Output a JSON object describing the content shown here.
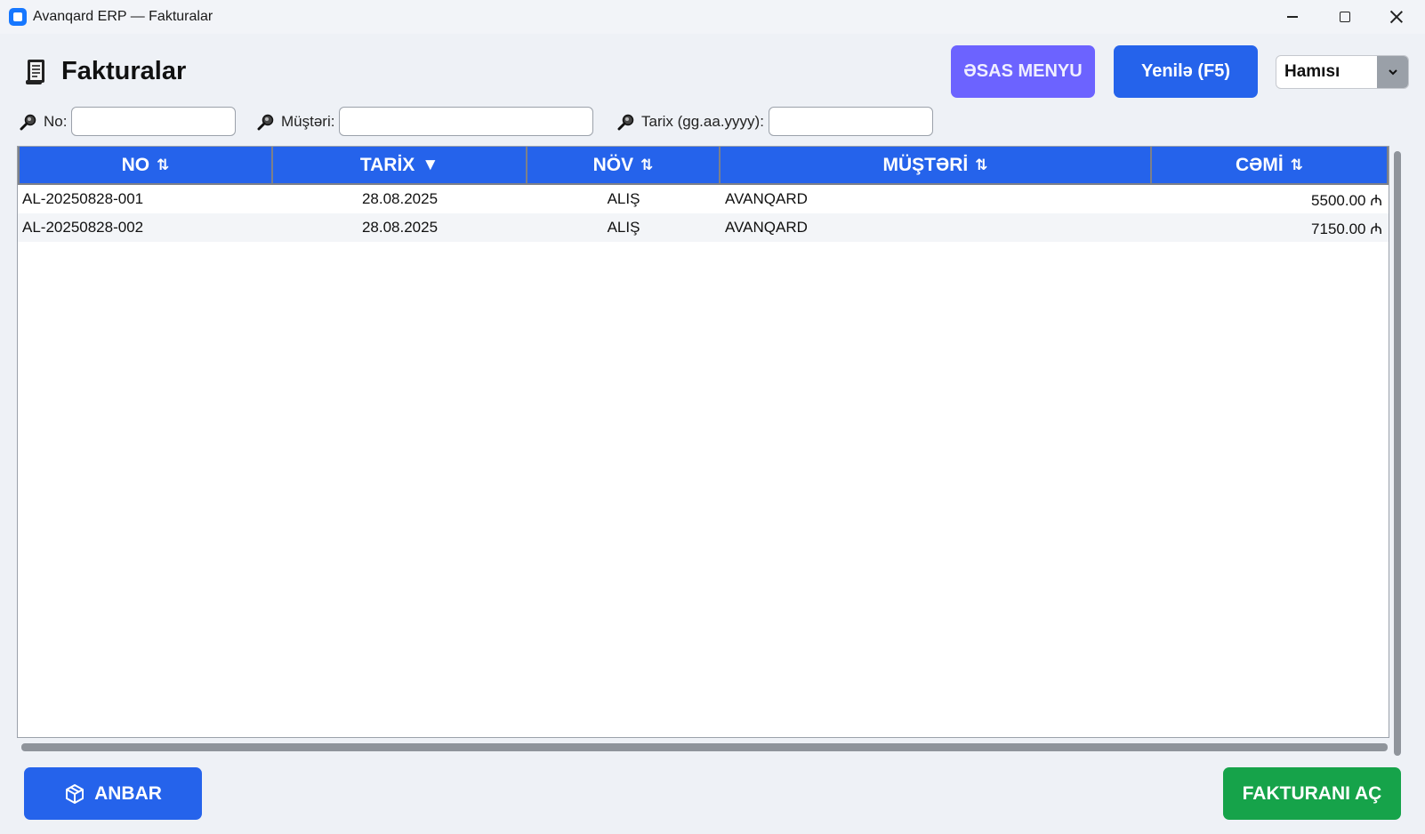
{
  "window": {
    "title": "Avanqard ERP — Fakturalar",
    "icon": "app-icon",
    "controls": [
      "minimize-icon",
      "maximize-icon",
      "close-icon"
    ]
  },
  "header": {
    "title": "Fakturalar",
    "title_icon": "document-icon",
    "main_menu_label": "ƏSAS MENYU",
    "refresh_label": "Yenilə (F5)",
    "filter_value": "Hamısı"
  },
  "search": {
    "no_label": "No:",
    "no_value": "",
    "customer_label": "Müştəri:",
    "customer_value": "",
    "date_label": "Tarix (gg.aa.yyyy):",
    "date_value": ""
  },
  "table": {
    "columns": [
      {
        "label": "NO",
        "sort": "⇅"
      },
      {
        "label": "TARİX",
        "sort": "▼"
      },
      {
        "label": "NÖV",
        "sort": "⇅"
      },
      {
        "label": "MÜŞTƏRİ",
        "sort": "⇅"
      },
      {
        "label": "CƏMİ",
        "sort": "⇅"
      }
    ],
    "rows": [
      {
        "no": "AL-20250828-001",
        "date": "28.08.2025",
        "type": "ALIŞ",
        "customer": "AVANQARD",
        "total": "5500.00 ₼"
      },
      {
        "no": "AL-20250828-002",
        "date": "28.08.2025",
        "type": "ALIŞ",
        "customer": "AVANQARD",
        "total": "7150.00 ₼"
      }
    ]
  },
  "footer": {
    "warehouse_label": "ANBAR",
    "warehouse_icon": "box-icon",
    "open_invoice_label": "FAKTURANI AÇ"
  },
  "colors": {
    "primary": "#2563eb",
    "menu": "#6c63ff",
    "success": "#16a34a",
    "background": "#eef1f6"
  }
}
